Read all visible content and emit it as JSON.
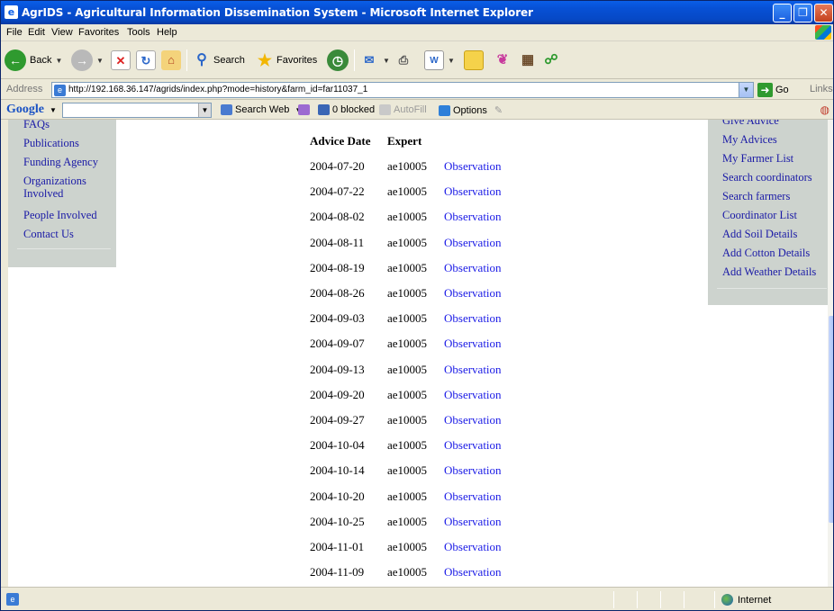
{
  "window": {
    "title": "AgrIDS - Agricultural Information Dissemination System - Microsoft Internet Explorer"
  },
  "menu": {
    "items": [
      "File",
      "Edit",
      "View",
      "Favorites",
      "Tools",
      "Help"
    ]
  },
  "toolbar": {
    "back_label": "Back",
    "search_label": "Search",
    "favorites_label": "Favorites"
  },
  "address": {
    "label": "Address",
    "url": "http://192.168.36.147/agrids/index.php?mode=history&farm_id=far11037_1",
    "go_label": "Go",
    "links_label": "Links"
  },
  "google_toolbar": {
    "logo": "Google",
    "search_web_label": "Search Web",
    "blocked_label": "0 blocked",
    "autofill_label": "AutoFill",
    "options_label": "Options"
  },
  "left_nav": {
    "items": [
      "FAQs",
      "Publications",
      "Funding Agency",
      "Organizations Involved",
      "People Involved",
      "Contact Us"
    ]
  },
  "right_nav": {
    "items": [
      "Give Advice",
      "My Advices",
      "My Farmer List",
      "Search coordinators",
      "Search farmers",
      "Coordinator List",
      "Add Soil Details",
      "Add Cotton Details",
      "Add Weather Details"
    ]
  },
  "advice_table": {
    "headers": {
      "date": "Advice Date",
      "expert": "Expert"
    },
    "rows": [
      {
        "date": "2004-07-20",
        "expert": "ae10005",
        "link": "Observation"
      },
      {
        "date": "2004-07-22",
        "expert": "ae10005",
        "link": "Observation"
      },
      {
        "date": "2004-08-02",
        "expert": "ae10005",
        "link": "Observation"
      },
      {
        "date": "2004-08-11",
        "expert": "ae10005",
        "link": "Observation"
      },
      {
        "date": "2004-08-19",
        "expert": "ae10005",
        "link": "Observation"
      },
      {
        "date": "2004-08-26",
        "expert": "ae10005",
        "link": "Observation"
      },
      {
        "date": "2004-09-03",
        "expert": "ae10005",
        "link": "Observation"
      },
      {
        "date": "2004-09-07",
        "expert": "ae10005",
        "link": "Observation"
      },
      {
        "date": "2004-09-13",
        "expert": "ae10005",
        "link": "Observation"
      },
      {
        "date": "2004-09-20",
        "expert": "ae10005",
        "link": "Observation"
      },
      {
        "date": "2004-09-27",
        "expert": "ae10005",
        "link": "Observation"
      },
      {
        "date": "2004-10-04",
        "expert": "ae10005",
        "link": "Observation"
      },
      {
        "date": "2004-10-14",
        "expert": "ae10005",
        "link": "Observation"
      },
      {
        "date": "2004-10-20",
        "expert": "ae10005",
        "link": "Observation"
      },
      {
        "date": "2004-10-25",
        "expert": "ae10005",
        "link": "Observation"
      },
      {
        "date": "2004-11-01",
        "expert": "ae10005",
        "link": "Observation"
      },
      {
        "date": "2004-11-09",
        "expert": "ae10005",
        "link": "Observation"
      }
    ]
  },
  "status": {
    "zone": "Internet"
  },
  "colors": {
    "titlebar": "#0a5ee8",
    "nav_background": "#cdd3ce",
    "link": "#1a1aa6"
  }
}
